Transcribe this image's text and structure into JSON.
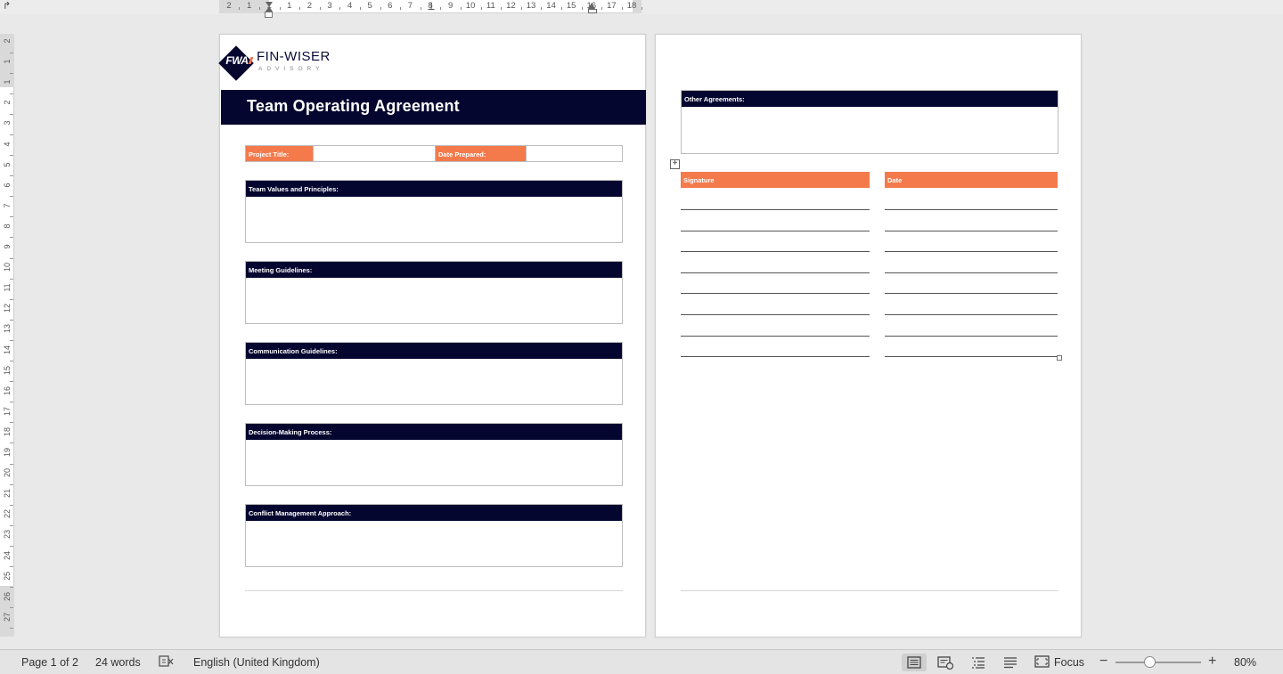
{
  "ruler": {
    "top_labels": [
      "2",
      "1",
      "1",
      "1",
      "2",
      "3",
      "4",
      "5",
      "6",
      "7",
      "8",
      "9",
      "10",
      "11",
      "12",
      "13",
      "14",
      "15",
      "16",
      "17",
      "18"
    ],
    "left_labels": [
      "2",
      "1",
      "1",
      "2",
      "3",
      "4",
      "5",
      "6",
      "7",
      "8",
      "9",
      "10",
      "11",
      "12",
      "13",
      "14",
      "15",
      "16",
      "17",
      "18",
      "19",
      "20",
      "21",
      "22",
      "23",
      "24",
      "25",
      "26",
      "27"
    ]
  },
  "page1": {
    "logo": {
      "mark": "FWA",
      "name": "FIN-WISER",
      "sub": "ADVISORY"
    },
    "title": "Team Operating Agreement",
    "project_title_label": "Project Title:",
    "project_title_value": "",
    "date_prepared_label": "Date Prepared:",
    "date_prepared_value": "",
    "sections": [
      {
        "heading": "Team Values and Principles:",
        "body": ""
      },
      {
        "heading": "Meeting Guidelines:",
        "body": ""
      },
      {
        "heading": "Communication Guidelines:",
        "body": ""
      },
      {
        "heading": "Decision-Making Process:",
        "body": ""
      },
      {
        "heading": "Conflict Management Approach:",
        "body": ""
      }
    ]
  },
  "page2": {
    "other_agreements_label": "Other Agreements:",
    "other_agreements_value": "",
    "signature_label": "Signature",
    "date_label": "Date",
    "signature_rows": 8
  },
  "status_bar": {
    "page_info": "Page 1 of 2",
    "word_count": "24 words",
    "language": "English (United Kingdom)",
    "focus_label": "Focus",
    "zoom": "80%",
    "zoom_minus": "−",
    "zoom_plus": "+"
  },
  "colors": {
    "navy": "#05062f",
    "orange": "#f47a4c"
  }
}
